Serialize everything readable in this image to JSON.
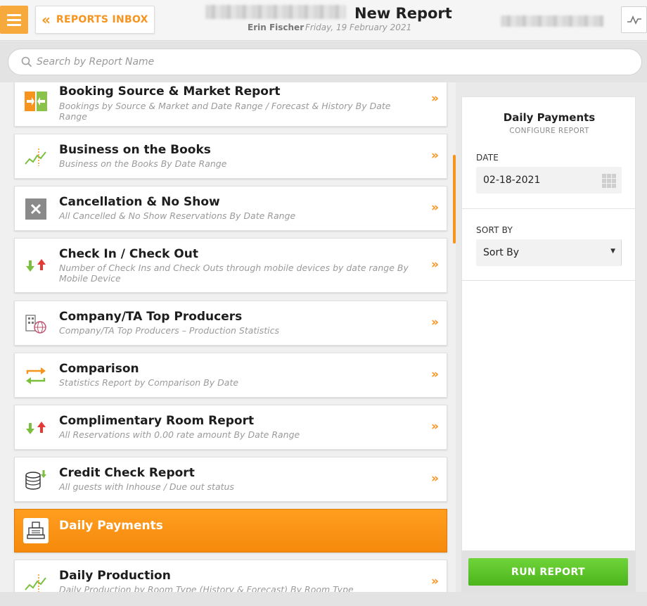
{
  "header": {
    "back_label": "REPORTS INBOX",
    "page_title": "New Report",
    "user_name": "Erin Fischer",
    "date": "Friday, 19 February 2021"
  },
  "search": {
    "placeholder": "Search by Report Name"
  },
  "reports": [
    {
      "name": "Booking Source & Market Report",
      "description": "Bookings by Source & Market and Date Range / Forecast & History By Date Range",
      "icon": "split-arrow-icon",
      "active": false
    },
    {
      "name": "Business on the Books",
      "description": "Business on the Books By Date Range",
      "icon": "trend-chart-icon",
      "active": false
    },
    {
      "name": "Cancellation & No Show",
      "description": "All Cancelled & No Show Reservations By Date Range",
      "icon": "close-box-icon",
      "active": false
    },
    {
      "name": "Check In / Check Out",
      "description": "Number of Check Ins and Check Outs through mobile devices by date range By Mobile Device",
      "icon": "up-down-arrows-icon",
      "active": false
    },
    {
      "name": "Company/TA Top Producers",
      "description": "Company/TA Top Producers – Production Statistics",
      "icon": "building-globe-icon",
      "active": false
    },
    {
      "name": "Comparison",
      "description": "Statistics Report by Comparison By Date",
      "icon": "compare-arrows-icon",
      "active": false
    },
    {
      "name": "Complimentary Room Report",
      "description": "All Reservations with 0.00 rate amount By Date Range",
      "icon": "up-down-arrows-icon",
      "active": false
    },
    {
      "name": "Credit Check Report",
      "description": "All guests with Inhouse / Due out status",
      "icon": "coin-stack-icon",
      "active": false
    },
    {
      "name": "Daily Payments",
      "description": "",
      "icon": "cash-register-icon",
      "active": true
    },
    {
      "name": "Daily Production",
      "description": "Daily Production by Room Type (History & Forecast) By Room Type",
      "icon": "trend-chart-icon",
      "active": false
    }
  ],
  "config": {
    "title": "Daily Payments",
    "subtitle": "CONFIGURE REPORT",
    "date_label": "DATE",
    "date_value": "02-18-2021",
    "sort_label": "SORT BY",
    "sort_value": "Sort By",
    "run_label": "RUN REPORT"
  },
  "colors": {
    "accent": "#f7941d",
    "run_button": "#5cc42a",
    "menu_button": "#f7a93b"
  }
}
